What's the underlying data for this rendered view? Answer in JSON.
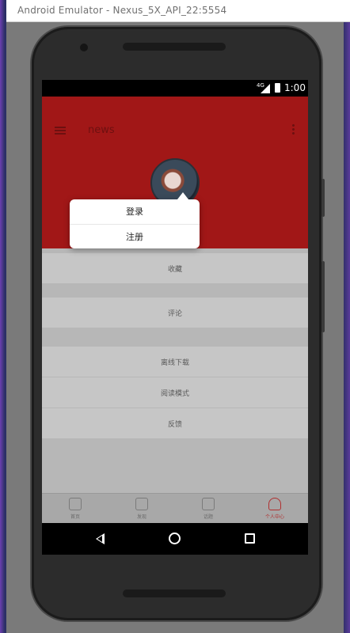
{
  "window": {
    "title": "Android Emulator - Nexus_5X_API_22:5554"
  },
  "status_bar": {
    "network": "4G",
    "time": "1:00"
  },
  "app": {
    "title": "news"
  },
  "profile": {
    "username": ""
  },
  "menu_rows": [
    {
      "label": "收藏"
    },
    {
      "label": "评论"
    },
    {
      "label": "离线下载"
    },
    {
      "label": "阅读模式"
    },
    {
      "label": "反馈"
    }
  ],
  "tabs": [
    {
      "label": "首页",
      "icon": "home-icon"
    },
    {
      "label": "发现",
      "icon": "discover-icon"
    },
    {
      "label": "话题",
      "icon": "topic-icon"
    },
    {
      "label": "个人中心",
      "icon": "person-icon"
    }
  ],
  "popup": {
    "items": [
      "登录",
      "注册"
    ]
  },
  "colors": {
    "header": "#a11717",
    "accent": "#b03030"
  }
}
